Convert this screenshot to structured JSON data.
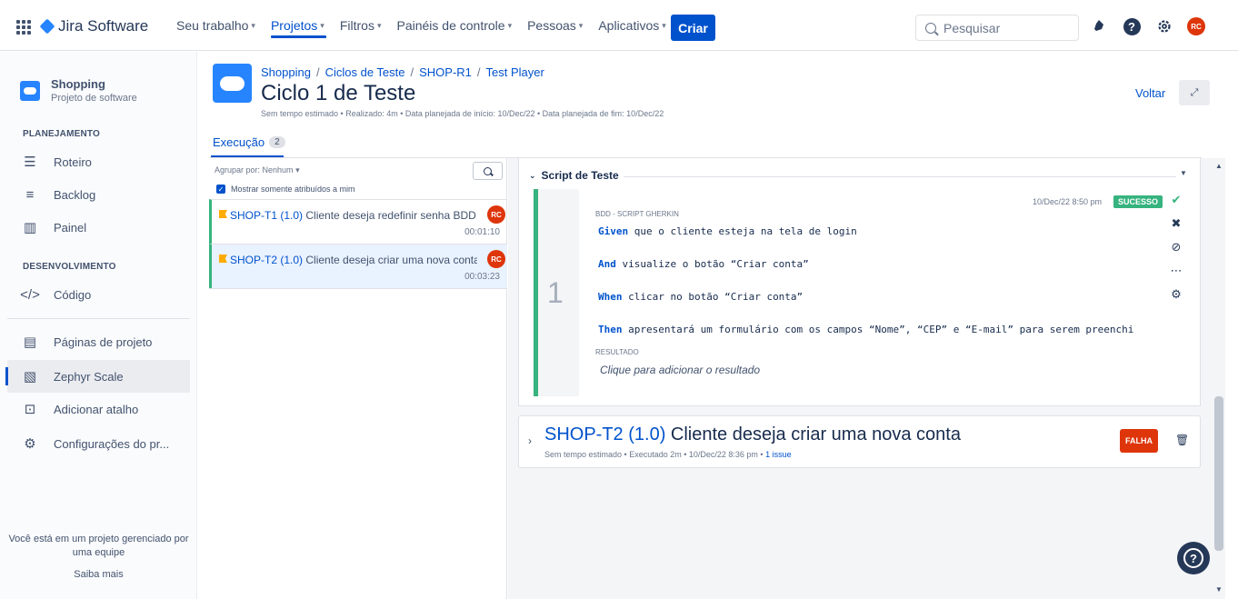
{
  "top": {
    "app_name": "Jira Software",
    "nav": [
      {
        "label": "Seu trabalho"
      },
      {
        "label": "Projetos"
      },
      {
        "label": "Filtros"
      },
      {
        "label": "Painéis de controle"
      },
      {
        "label": "Pessoas"
      },
      {
        "label": "Aplicativos"
      }
    ],
    "create": "Criar",
    "search_placeholder": "Pesquisar",
    "avatar": "RC",
    "help": "?"
  },
  "sidebar": {
    "project_name": "Shopping",
    "project_type": "Projeto de software",
    "planning_title": "PLANEJAMENTO",
    "planning": [
      {
        "label": "Roteiro"
      },
      {
        "label": "Backlog"
      },
      {
        "label": "Painel"
      }
    ],
    "dev_title": "DESENVOLVIMENTO",
    "dev": [
      {
        "label": "Código"
      }
    ],
    "other": [
      {
        "label": "Páginas de projeto"
      },
      {
        "label": "Zephyr Scale"
      },
      {
        "label": "Adicionar atalho"
      },
      {
        "label": "Configurações do pr..."
      }
    ],
    "footer_line1": "Você está em um projeto gerenciado por",
    "footer_line2": "uma equipe",
    "footer_link": "Saiba mais"
  },
  "page": {
    "breadcrumb": [
      "Shopping",
      "Ciclos de Teste",
      "SHOP-R1",
      "Test Player"
    ],
    "title": "Ciclo 1 de Teste",
    "meta": "Sem tempo estimado  •  Realizado: 4m  •  Data planejada de início: 10/Dec/22  •  Data planejada de fim: 10/Dec/22",
    "back": "Voltar",
    "tab_label": "Execução",
    "tab_count": "2"
  },
  "list": {
    "group_by": "Agrupar por: Nenhum",
    "only_mine": "Mostrar somente atribuídos a mim",
    "cases": [
      {
        "key": "SHOP-T1 (1.0)",
        "title": "Cliente deseja redefinir senha BDD",
        "time": "00:01:10",
        "avatar": "RC"
      },
      {
        "key": "SHOP-T2 (1.0)",
        "title": "Cliente deseja criar uma nova conta",
        "time": "00:03:23",
        "avatar": "RC"
      }
    ]
  },
  "script": {
    "header": "Script de Teste",
    "step_number": "1",
    "timestamp": "10/Dec/22 8:50 pm",
    "status": "SUCESSO",
    "label": "BDD - SCRIPT GHERKIN",
    "lines": [
      {
        "kw": "Given",
        "text": " que o cliente esteja na tela de login"
      },
      {
        "kw": "And",
        "text": " visualize o botão “Criar conta”"
      },
      {
        "kw": "When",
        "text": " clicar no botão “Criar conta”"
      },
      {
        "kw": "Then",
        "text": " apresentará um formulário com os campos “Nome”, “CEP”  e “E-mail” para serem preenchi"
      }
    ],
    "result_label": "RESULTADO",
    "result_placeholder": "Clique para adicionar o resultado"
  },
  "card2": {
    "key": "SHOP-T2 (1.0)",
    "title": " Cliente deseja criar uma nova conta",
    "meta": "Sem tempo estimado  •  Executado 2m  •  10/Dec/22 8:36 pm  •  ",
    "issue_link": "1 issue",
    "status": "FALHA"
  },
  "colors": {
    "accent": "#0052cc",
    "success": "#36b37e",
    "fail": "#de350b"
  }
}
